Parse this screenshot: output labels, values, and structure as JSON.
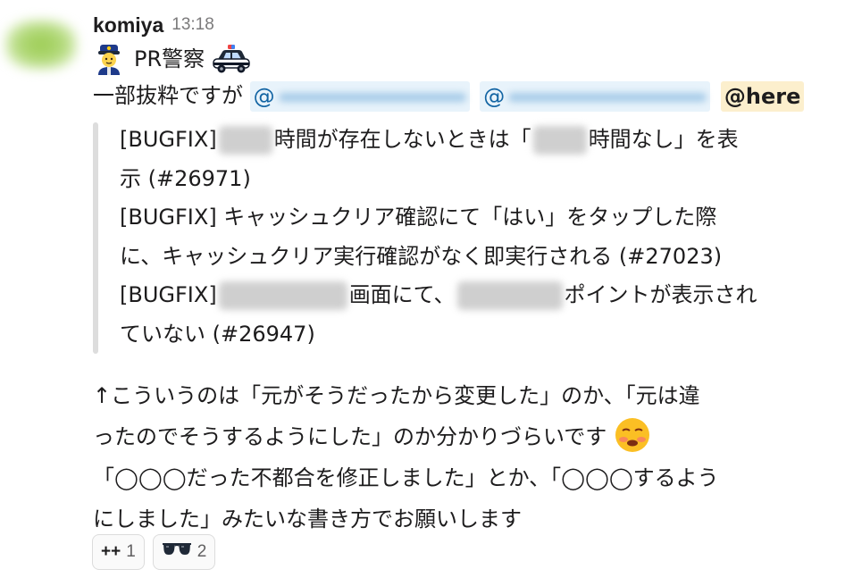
{
  "message": {
    "username": "komiya",
    "timestamp": "13:18",
    "title_text": "PR警察",
    "icons": {
      "title_left": "police-officer-emoji",
      "title_right": "police-car-emoji",
      "face": "pleading-face-emoji"
    },
    "mention_line": {
      "prefix": "一部抜粋ですが ",
      "mention_1_at": "@",
      "mention_2_at": "@",
      "mention_here": "@here"
    },
    "quote": {
      "l1a": "[BUGFIX]",
      "l1b": "時間が存在しないときは「",
      "l1c": "時間なし」を表",
      "l2": "示 (#26971)",
      "l3": "[BUGFIX] キャッシュクリア確認にて「はい」をタップした際",
      "l4": "に、キャッシュクリア実行確認がなく即実行される (#27023)",
      "l5a": "[BUGFIX]",
      "l5b": "画面にて、",
      "l5c": "ポイントが表示され",
      "l6": "ていない (#26947)"
    },
    "body": {
      "l1": "↑こういうのは「元がそうだったから変更した」のか、「元は違",
      "l2": "ったのでそうするようにした」のか分かりづらいです ",
      "l3": "「◯◯◯だった不都合を修正しました」とか、「◯◯◯するよう",
      "l4": "にしました」みたいな書き方でお願いします"
    }
  },
  "reactions": [
    {
      "emoji": "++",
      "count": "1"
    },
    {
      "emoji": "sunglasses-emoji",
      "count": "2"
    }
  ]
}
